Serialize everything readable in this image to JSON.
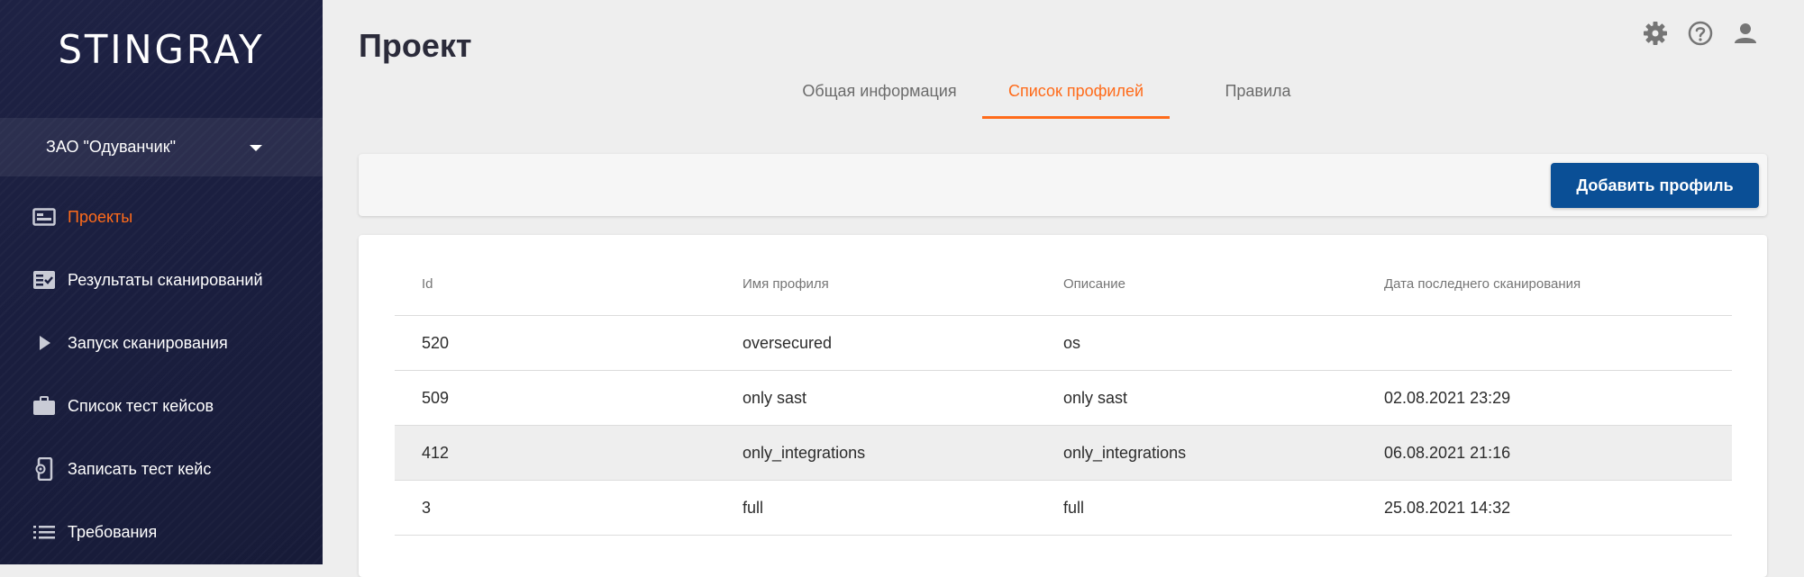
{
  "sidebar": {
    "logo": "STINGRAY",
    "org": "ЗАО \"Одуванчик\"",
    "items": [
      {
        "label": "Проекты",
        "icon": "projects-icon",
        "active": true
      },
      {
        "label": "Результаты сканирований",
        "icon": "scan-results-icon"
      },
      {
        "label": "Запуск сканирования",
        "icon": "play-icon"
      },
      {
        "label": "Список тест кейсов",
        "icon": "briefcase-icon"
      },
      {
        "label": "Записать тест кейс",
        "icon": "record-phone-icon"
      },
      {
        "label": "Требования",
        "icon": "list-icon"
      }
    ]
  },
  "header": {
    "title": "Проект",
    "icons": [
      "gear-icon",
      "help-icon",
      "user-icon"
    ]
  },
  "tabs": [
    {
      "label": "Общая информация"
    },
    {
      "label": "Список профилей",
      "active": true
    },
    {
      "label": "Правила"
    }
  ],
  "toolbar": {
    "add_label": "Добавить профиль"
  },
  "table": {
    "columns": [
      "Id",
      "Имя профиля",
      "Описание",
      "Дата последнего сканирования"
    ],
    "rows": [
      [
        "520",
        "oversecured",
        "os",
        ""
      ],
      [
        "509",
        "only sast",
        "only sast",
        "02.08.2021 23:29"
      ],
      [
        "412",
        "only_integrations",
        "only_integrations",
        "06.08.2021 21:16"
      ],
      [
        "3",
        "full",
        "full",
        "25.08.2021 14:32"
      ]
    ]
  },
  "colors": {
    "accent": "#ff6b1a",
    "primary_button": "#0a4f96",
    "sidebar_bg": "#1b1f40"
  }
}
